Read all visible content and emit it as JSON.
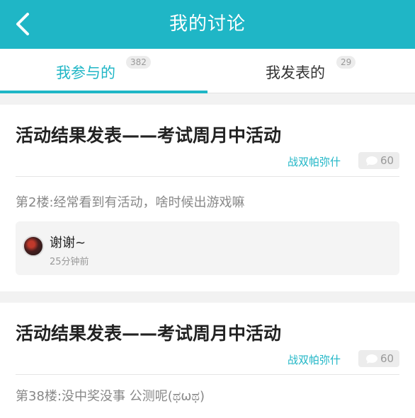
{
  "header": {
    "title": "我的讨论",
    "back_icon": "chevron-left-icon"
  },
  "tabs": [
    {
      "label": "我参与的",
      "badge": "382",
      "active": true
    },
    {
      "label": "我发表的",
      "badge": "29",
      "active": false
    }
  ],
  "posts": [
    {
      "title": "活动结果发表——考试周月中活动",
      "author": "战双帕弥什",
      "comment_count": "60",
      "comment_icon": "speech-bubble-icon",
      "reply_text": "第2楼:经常看到有活动，啥时候出游戏嘛",
      "sub_reply": {
        "name": "谢谢~",
        "time": "25分钟前"
      }
    },
    {
      "title": "活动结果发表——考试周月中活动",
      "author": "战双帕弥什",
      "comment_count": "60",
      "comment_icon": "speech-bubble-icon",
      "reply_text": "第38楼:没中奖没事  公测呢(ಥωಥ)"
    }
  ],
  "colors": {
    "accent": "#1fb6c6",
    "background": "#f2f2f2",
    "card": "#ffffff"
  }
}
